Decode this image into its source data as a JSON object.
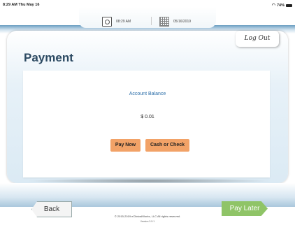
{
  "statusbar": {
    "time": "8:29 AM",
    "date": "Thu May 16",
    "battery": "74%",
    "icons": [
      "wifi-icon",
      "battery-icon"
    ]
  },
  "header": {
    "clock_time": "08:29 AM",
    "date": "05/16/2019",
    "icons": [
      "clock-icon",
      "calendar-icon"
    ]
  },
  "logout_label": "Log Out",
  "page": {
    "title": "Payment",
    "balance_label": "Account Balance",
    "balance_value": "$ 0.01"
  },
  "buttons": {
    "pay_now": "Pay Now",
    "cash_or_check": "Cash or Check",
    "back": "Back",
    "pay_later": "Pay Later"
  },
  "footer": {
    "copyright": "© 2015-2019 eClinicalWorks, LLC All rights reserved.",
    "version": "Version 3.5.1"
  },
  "colors": {
    "accent_orange": "#f2a267",
    "pay_later_green": "#8fc467",
    "title_navy": "#2c4a62",
    "balance_blue": "#2a6da8"
  }
}
